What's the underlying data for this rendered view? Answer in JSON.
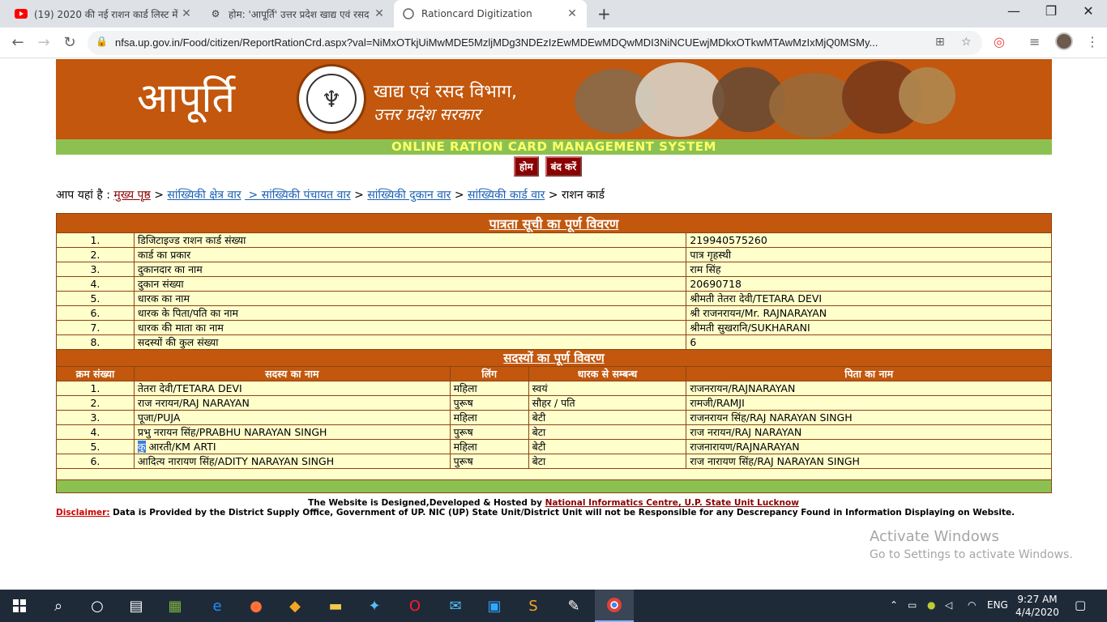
{
  "browser": {
    "tabs": [
      {
        "title": "(19) 2020 की नई राशन कार्ड लिस्ट में"
      },
      {
        "title": "होम: 'आपूर्ति' उत्तर प्रदेश खाद्य एवं रसद"
      },
      {
        "title": "Rationcard Digitization"
      }
    ],
    "url": "nfsa.up.gov.in/Food/citizen/ReportRationCrd.aspx?val=NiMxOTkjUiMwMDE5MzljMDg3NDEzIzEwMDEwMDQwMDI3NiNCUEwjMDkxOTkwMTAwMzIxMjQ0MSMy..."
  },
  "header": {
    "brand": "आपूर्ति",
    "dept_line1": "खाद्य एवं रसद विभाग,",
    "dept_line2": "उत्तर प्रदेश सरकार",
    "system_title": "ONLINE RATION CARD MANAGEMENT SYSTEM",
    "home_btn": "होम",
    "close_btn": "बंद करें"
  },
  "breadcrumb": {
    "prefix": "आप यहां है : ",
    "home": "मुख्य पृष्ठ",
    "sep": " > ",
    "l1": "सांख्यिकी क्षेत्र वार",
    "l2": " > सांख्यिकी पंचायत वार",
    "l3": "सांख्यिकी दुकान वार",
    "l4": "सांख्यिकी कार्ड वार",
    "current": "राशन कार्ड"
  },
  "eligibility": {
    "title": "पात्रता सूची का पूर्ण विवरण",
    "rows": [
      {
        "n": "1.",
        "label": "डिजिटाइज्ड राशन कार्ड संख्या",
        "value": "219940575260"
      },
      {
        "n": "2.",
        "label": "कार्ड का प्रकार",
        "value": "पात्र गृहस्थी"
      },
      {
        "n": "3.",
        "label": "दुकानदार का नाम",
        "value": "राम सिंह"
      },
      {
        "n": "4.",
        "label": "दुकान संख्या",
        "value": "20690718"
      },
      {
        "n": "5.",
        "label": "धारक का नाम",
        "value": "श्रीमती तेतरा देवी/TETARA DEVI"
      },
      {
        "n": "6.",
        "label": "धारक के पिता/पति का नाम",
        "value": "श्री राजनरायन/Mr. RAJNARAYAN"
      },
      {
        "n": "7.",
        "label": "धारक की माता का नाम",
        "value": "श्रीमती सुखरानि/SUKHARANI"
      },
      {
        "n": "8.",
        "label": "सदस्यों की कुल संख्या",
        "value": "6"
      }
    ]
  },
  "members": {
    "title": "सदस्यों का पूर्ण विवरण",
    "columns": [
      "क्रम संख्या",
      "सदस्य का नाम",
      "लिंग",
      "धारक से सम्बन्ध",
      "पिता का नाम"
    ],
    "rows": [
      {
        "n": "1.",
        "name": "तेतरा देवी/TETARA DEVI",
        "gender": "महिला",
        "relation": "स्वयं",
        "father": "राजनरायन/RAJNARAYAN"
      },
      {
        "n": "2.",
        "name": "राज नरायन/RAJ NARAYAN",
        "gender": "पुरूष",
        "relation": "सौहर / पति",
        "father": "रामजी/RAMJI"
      },
      {
        "n": "3.",
        "name": "पूजा/PUJA",
        "gender": "महिला",
        "relation": "बेटी",
        "father": "राजनरायन सिंह/RAJ NARAYAN SINGH"
      },
      {
        "n": "4.",
        "name": "प्रभु नरायन सिंह/PRABHU NARAYAN SINGH",
        "gender": "पुरूष",
        "relation": "बेटा",
        "father": "राज नरायन/RAJ NARAYAN"
      },
      {
        "n": "5.",
        "name_sel": "कु",
        "name": " आरती/KM ARTI",
        "gender": "महिला",
        "relation": "बेटी",
        "father": "राजनारायण/RAJNARAYAN"
      },
      {
        "n": "6.",
        "name": "आदित्य नारायण सिंह/ADITY NARAYAN SINGH",
        "gender": "पुरूष",
        "relation": "बेटा",
        "father": "राज नारायण सिंह/RAJ NARAYAN SINGH"
      }
    ]
  },
  "footer": {
    "credit_prefix": "The Website is Designed,Developed & Hosted by ",
    "credit_link": " National Informatics Centre, U.P. State Unit Lucknow",
    "disclaimer_label": "Disclaimer:",
    "disclaimer_text": "  Data is Provided by the District Supply Office, Government of UP. NIC (UP) State Unit/District Unit will not be Responsible for any Descrepancy Found in Information Displaying on Website."
  },
  "watermark": {
    "line1": "Activate Windows",
    "line2": "Go to Settings to activate Windows."
  },
  "taskbar": {
    "lang": "ENG",
    "time": "9:27 AM",
    "date": "4/4/2020"
  },
  "colors": {
    "banner": "#c2570d",
    "green": "#8cc152",
    "cell": "#ffffcc"
  }
}
